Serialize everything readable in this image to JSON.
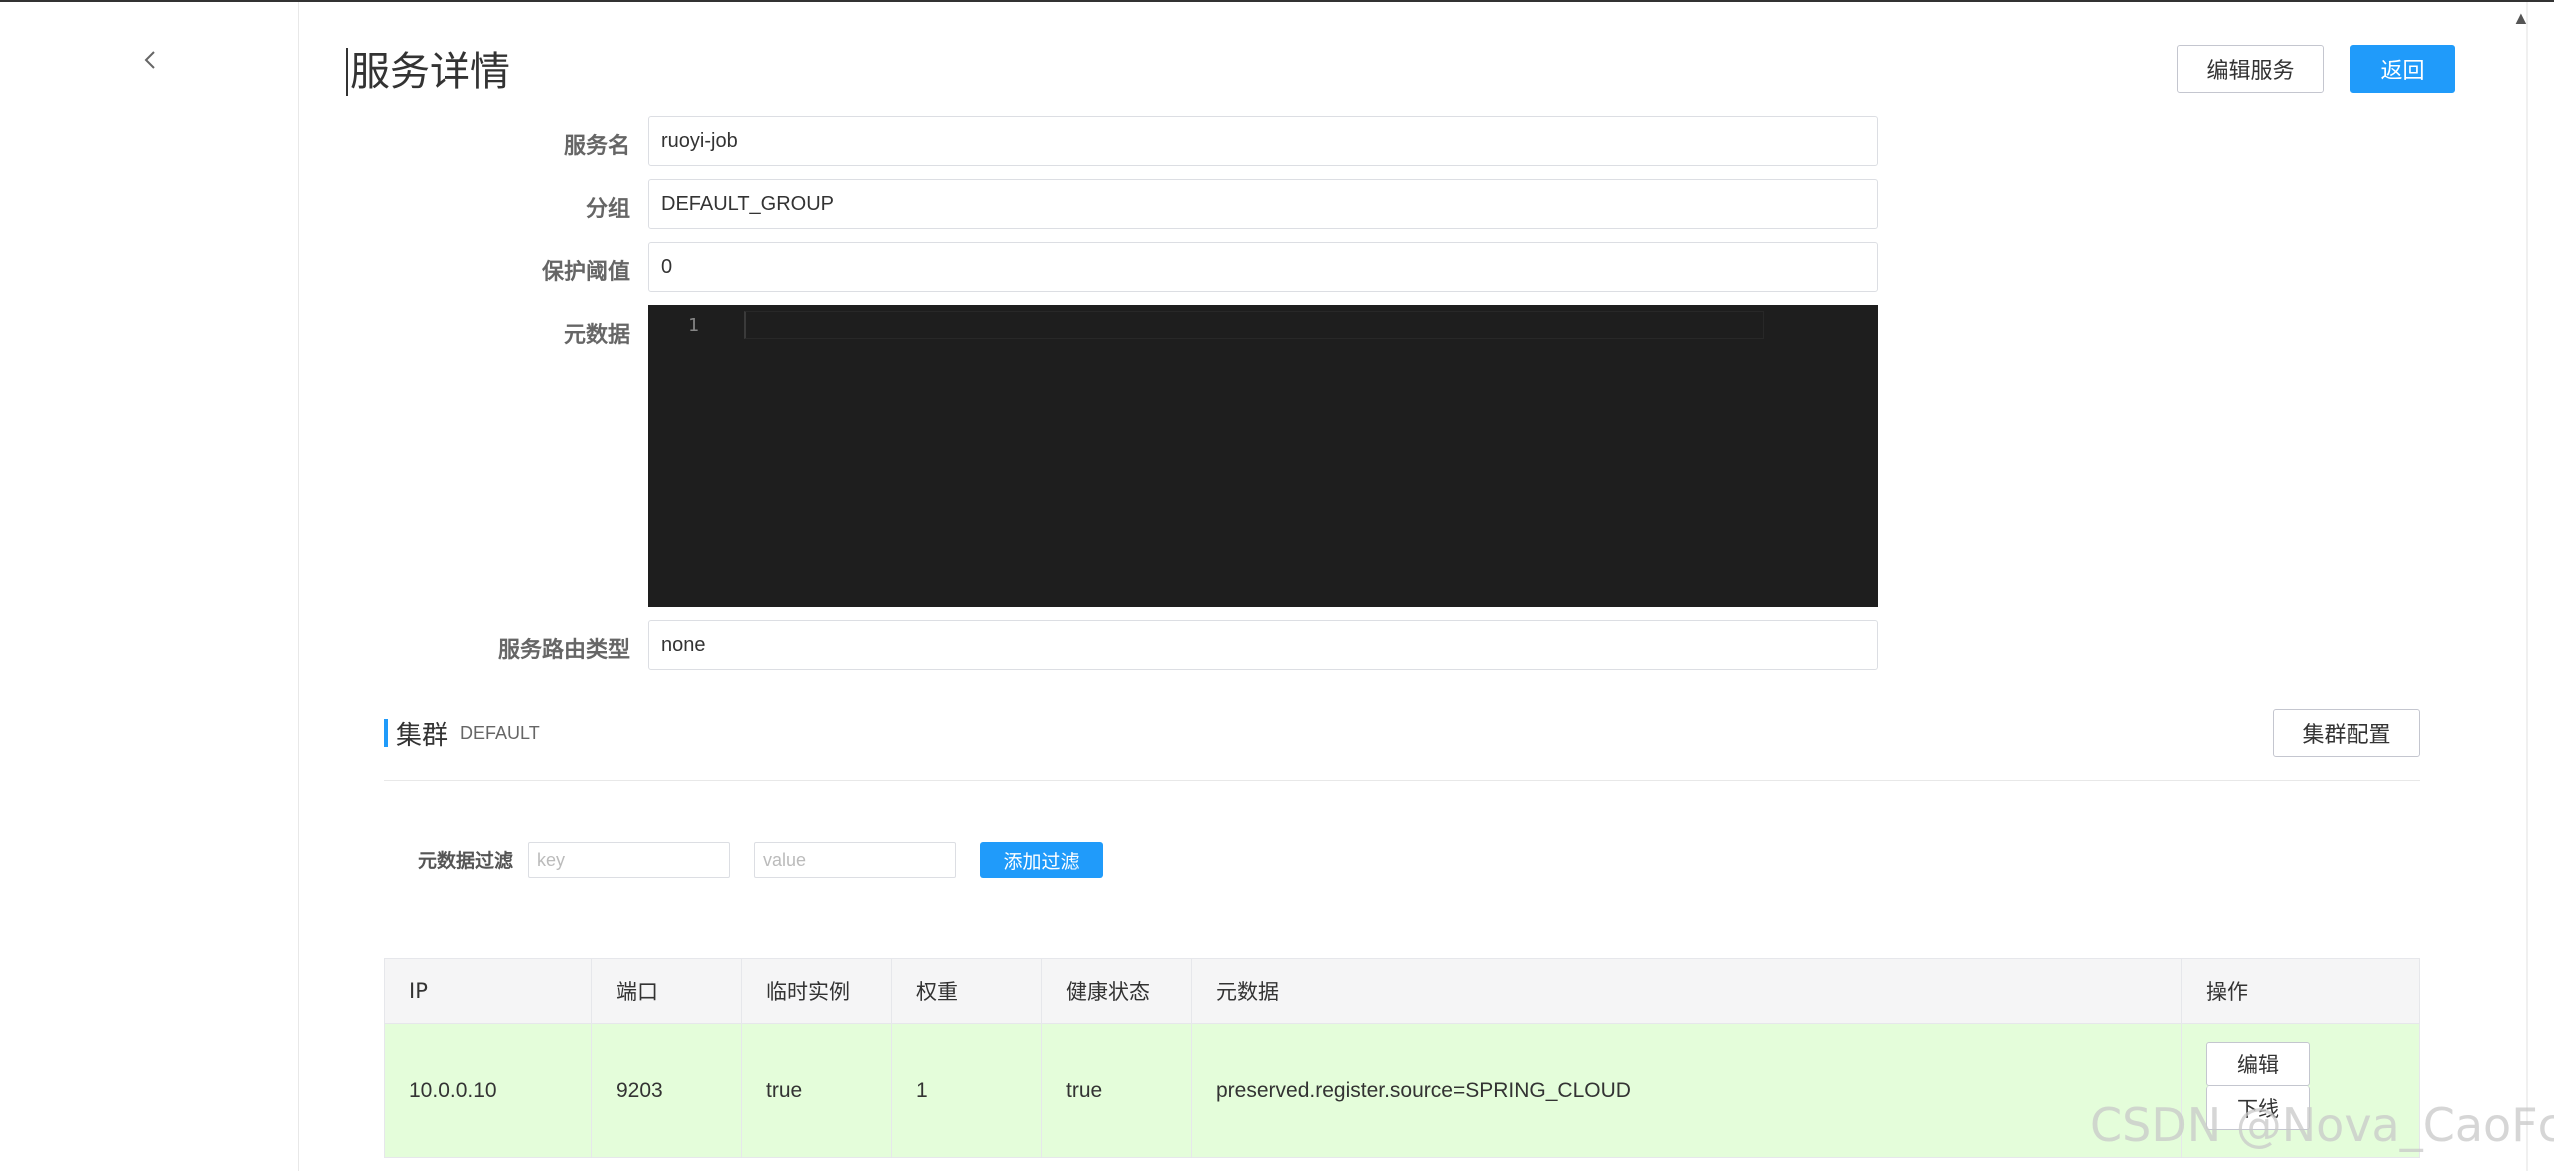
{
  "page": {
    "title": "服务详情",
    "edit_service_label": "编辑服务",
    "back_label": "返回"
  },
  "form": {
    "service_name_label": "服务名",
    "service_name_value": "ruoyi-job",
    "group_label": "分组",
    "group_value": "DEFAULT_GROUP",
    "threshold_label": "保护阈值",
    "threshold_value": "0",
    "metadata_label": "元数据",
    "editor_line_number": "1",
    "selector_type_label": "服务路由类型",
    "selector_type_value": "none"
  },
  "cluster": {
    "title": "集群",
    "name": "DEFAULT",
    "config_label": "集群配置"
  },
  "filter": {
    "label": "元数据过滤",
    "key_placeholder": "key",
    "value_placeholder": "value",
    "add_label": "添加过滤"
  },
  "table": {
    "headers": [
      "IP",
      "端口",
      "临时实例",
      "权重",
      "健康状态",
      "元数据",
      "操作"
    ],
    "rows": [
      {
        "ip": "10.0.0.10",
        "port": "9203",
        "ephemeral": "true",
        "weight": "1",
        "healthy": "true",
        "metadata": "preserved.register.source=SPRING_CLOUD",
        "edit_label": "编辑",
        "offline_label": "下线"
      }
    ]
  },
  "watermark": "CSDN @Nova_CaoFc",
  "colors": {
    "primary": "#209bfa",
    "healthy_row": "#e4fdda",
    "editor_bg": "#1e1e1e"
  }
}
